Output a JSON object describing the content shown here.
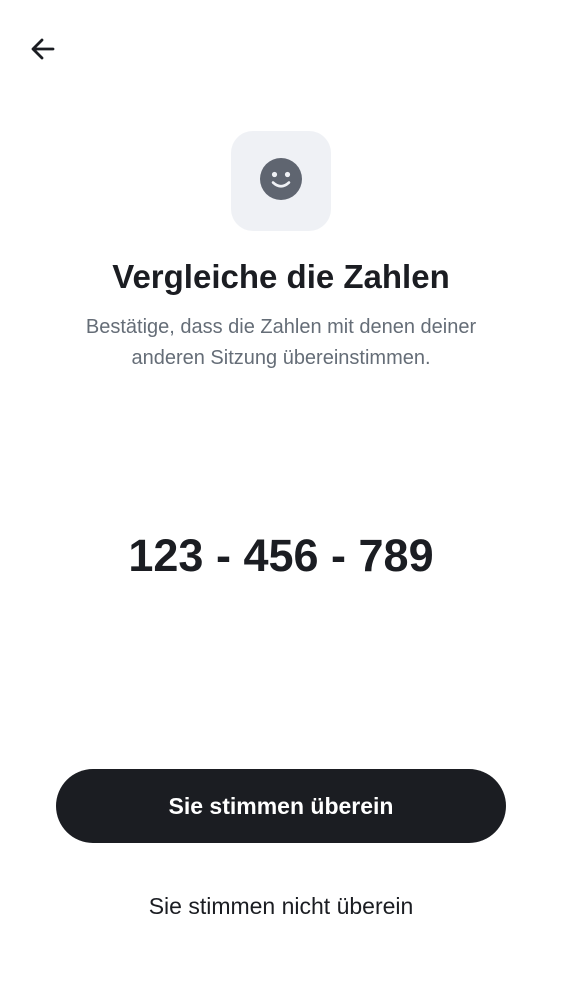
{
  "header": {
    "back_icon": "arrow-left-icon"
  },
  "hero": {
    "icon": "smiley-face-icon",
    "tile_color": "#eff1f5",
    "icon_color": "#5f6570"
  },
  "title": "Vergleiche die Zahlen",
  "subtitle": "Bestätige, dass die Zahlen mit denen deiner anderen Sitzung übereinstimmen.",
  "code": "123 - 456 - 789",
  "actions": {
    "confirm_label": "Sie stimmen überein",
    "deny_label": "Sie stimmen nicht überein"
  },
  "colors": {
    "primary": "#1b1d22",
    "muted_text": "#656d77",
    "background": "#ffffff"
  }
}
